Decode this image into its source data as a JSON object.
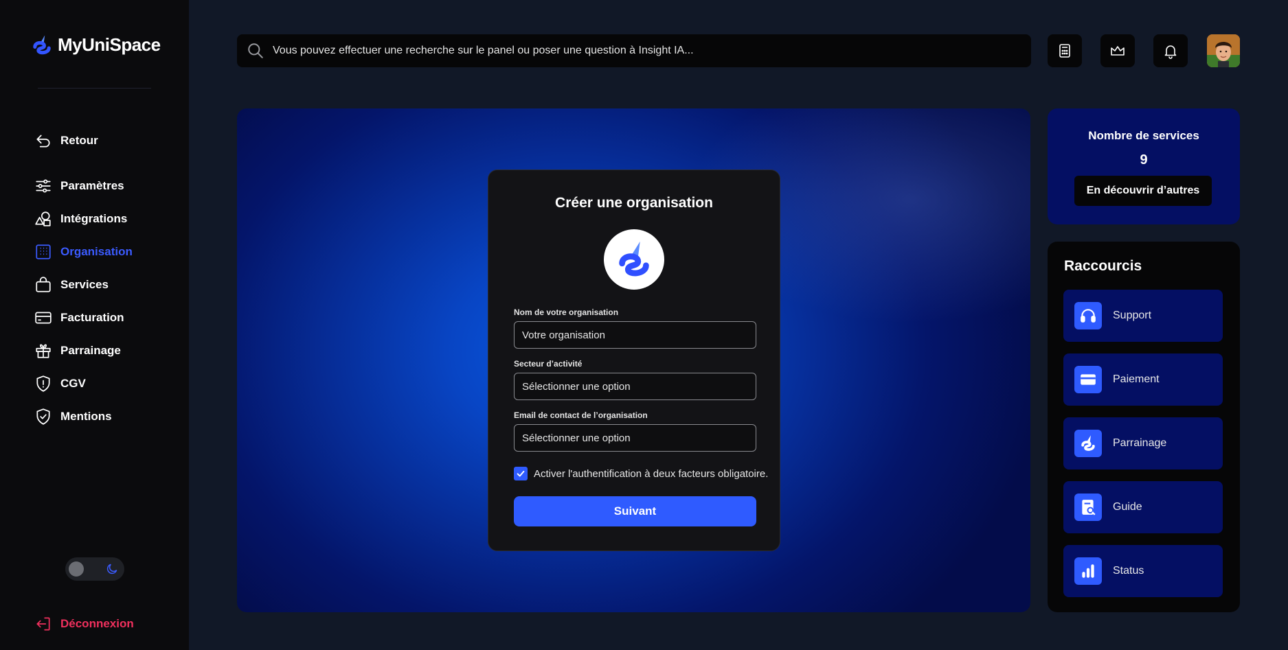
{
  "app": {
    "name": "MyUniSpace"
  },
  "sidebar": {
    "items": [
      {
        "label": "Retour"
      },
      {
        "label": "Paramètres"
      },
      {
        "label": "Intégrations"
      },
      {
        "label": "Organisation"
      },
      {
        "label": "Services"
      },
      {
        "label": "Facturation"
      },
      {
        "label": "Parrainage"
      },
      {
        "label": "CGV"
      },
      {
        "label": "Mentions"
      }
    ],
    "logout_label": "Déconnexion",
    "theme": "dark"
  },
  "search": {
    "placeholder": "Vous pouvez effectuer une recherche sur le panel ou poser une question à Insight IA..."
  },
  "modal": {
    "title": "Créer une organisation",
    "fields": [
      {
        "label": "Nom de votre organisation",
        "placeholder": "Votre organisation"
      },
      {
        "label": "Secteur d’activité",
        "placeholder": "Sélectionner une option"
      },
      {
        "label": "Email de contact de l’organisation",
        "placeholder": "Sélectionner une option"
      }
    ],
    "two_factor": {
      "label": "Activer l'authentification à deux facteurs obligatoire.",
      "checked": true
    },
    "submit_label": "Suivant"
  },
  "services_card": {
    "title": "Nombre de services",
    "count": "9",
    "button_label": "En découvrir d’autres"
  },
  "shortcuts": {
    "title": "Raccourcis",
    "items": [
      {
        "label": "Support",
        "icon": "headphones-icon"
      },
      {
        "label": "Paiement",
        "icon": "card-icon"
      },
      {
        "label": "Parrainage",
        "icon": "brand-icon"
      },
      {
        "label": "Guide",
        "icon": "guide-icon"
      },
      {
        "label": "Status",
        "icon": "bar-chart-icon"
      }
    ]
  },
  "colors": {
    "accent": "#2f5bff",
    "active_nav": "#3b5bff",
    "logout": "#f0305d",
    "card_navy": "#040f63"
  }
}
